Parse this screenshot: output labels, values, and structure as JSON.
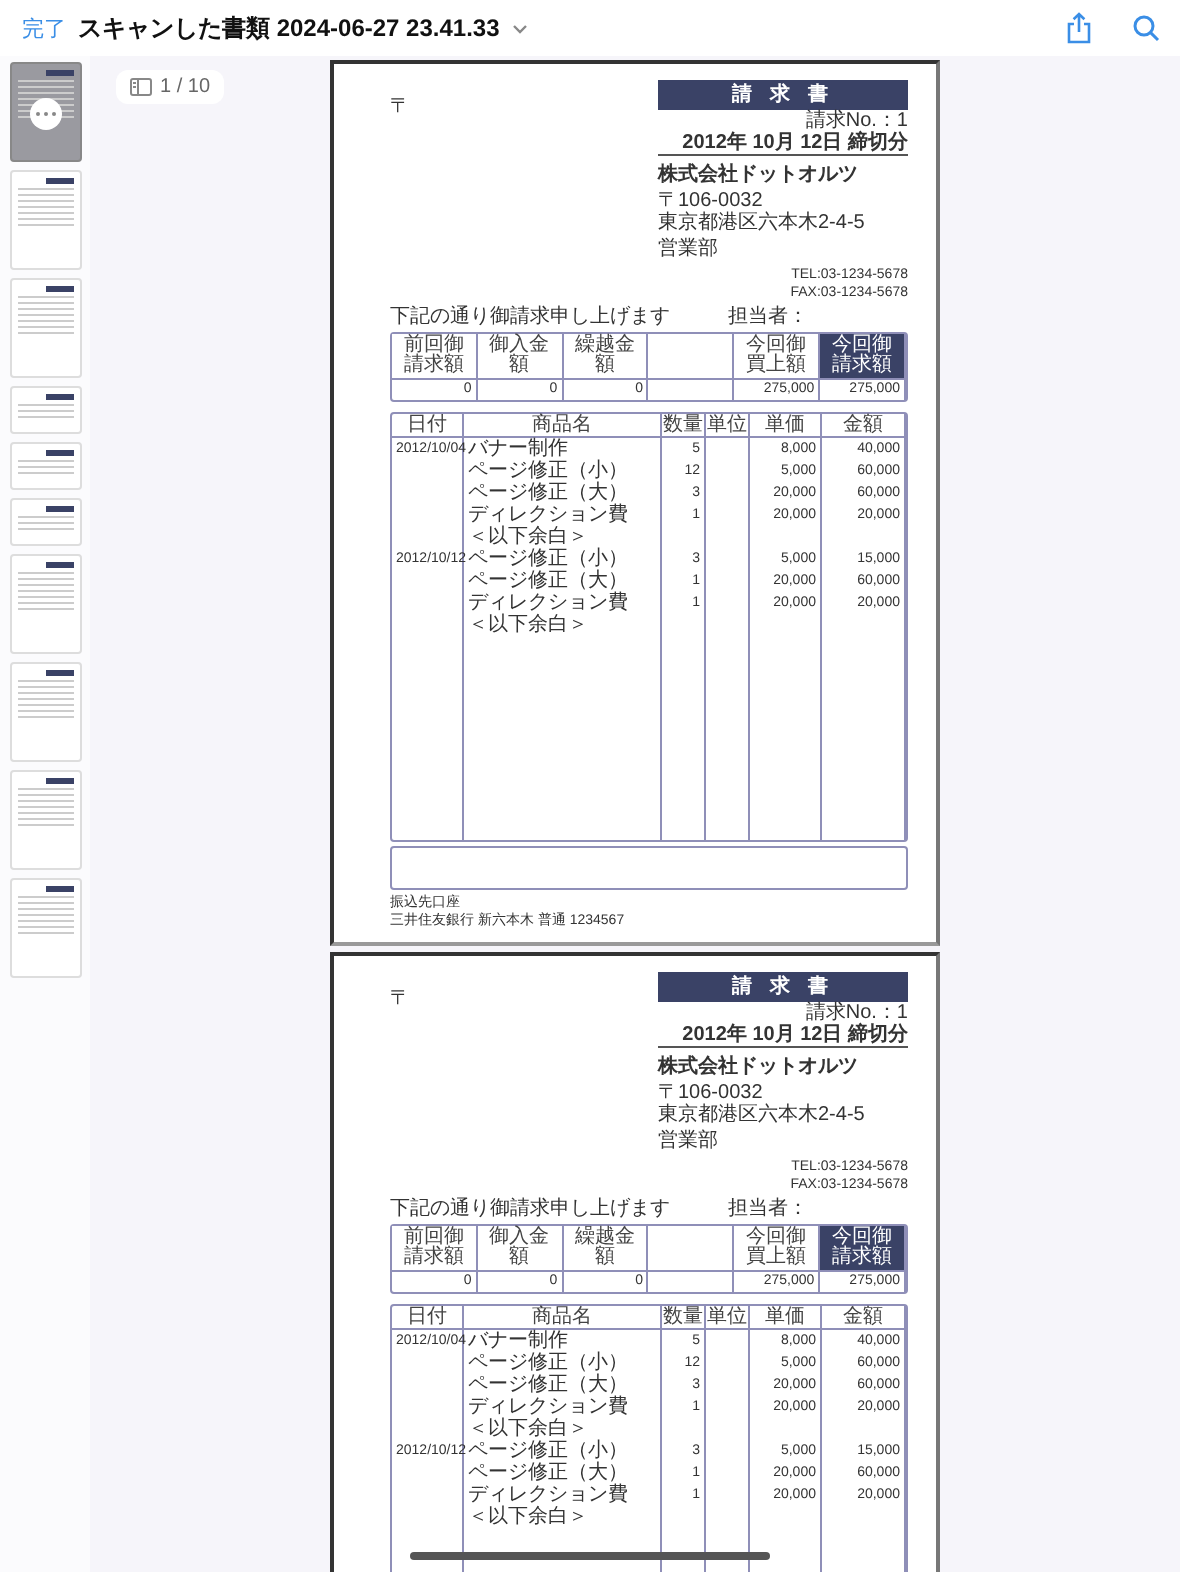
{
  "toolbar": {
    "done": "完了",
    "title": "スキャンした書類 2024-06-27 23.41.33"
  },
  "thumbnails": [
    {
      "selected": true,
      "kind": "portrait"
    },
    {
      "selected": false,
      "kind": "portrait"
    },
    {
      "selected": false,
      "kind": "portrait"
    },
    {
      "selected": false,
      "kind": "landscape"
    },
    {
      "selected": false,
      "kind": "landscape"
    },
    {
      "selected": false,
      "kind": "landscape"
    },
    {
      "selected": false,
      "kind": "portrait"
    },
    {
      "selected": false,
      "kind": "portrait"
    },
    {
      "selected": false,
      "kind": "portrait"
    },
    {
      "selected": false,
      "kind": "portrait"
    }
  ],
  "page_indicator": "1 / 10",
  "pages": [
    {
      "postal_mark": "〒",
      "title": "請 求 書",
      "invoice_no": "請求No.：1",
      "closing_date": "2012年 10月 12日 締切分",
      "company": "株式会社ドットオルツ",
      "postal_code": "〒106-0032",
      "address": "東京都港区六本木2-4-5",
      "department": "営業部",
      "tel": "TEL:03-1234-5678",
      "fax": "FAX:03-1234-5678",
      "message": "下記の通り御請求申し上げます",
      "contact": "担当者：",
      "summary": [
        {
          "label": "前回御請求額",
          "value": "0",
          "highlight": false
        },
        {
          "label": "御入金額",
          "value": "0",
          "highlight": false
        },
        {
          "label": "繰越金額",
          "value": "0",
          "highlight": false
        },
        {
          "highlight": false
        },
        {
          "label": "今回御買上額",
          "value": "275,000",
          "highlight": false
        },
        {
          "label": "今回御請求額",
          "value": "275,000",
          "highlight": true
        }
      ],
      "item_columns": [
        "日付",
        "商品名",
        "数量",
        "単位",
        "単価",
        "金額"
      ],
      "items": [
        {
          "date": "2012/10/04",
          "name": "バナー制作",
          "quantity": "5",
          "unit_price": "8,000",
          "amount": "40,000"
        },
        {
          "name": "ページ修正（小）",
          "quantity": "12",
          "unit_price": "5,000",
          "amount": "60,000"
        },
        {
          "name": "ページ修正（大）",
          "quantity": "3",
          "unit_price": "20,000",
          "amount": "60,000"
        },
        {
          "name": "ディレクション費",
          "quantity": "1",
          "unit_price": "20,000",
          "amount": "20,000"
        },
        {
          "name": "＜以下余白＞"
        },
        {
          "date": "2012/10/12",
          "name": "ページ修正（小）",
          "quantity": "3",
          "unit_price": "5,000",
          "amount": "15,000"
        },
        {
          "name": "ページ修正（大）",
          "quantity": "1",
          "unit_price": "20,000",
          "amount": "60,000"
        },
        {
          "name": "ディレクション費",
          "quantity": "1",
          "unit_price": "20,000",
          "amount": "20,000"
        },
        {
          "name": "＜以下余白＞"
        }
      ],
      "bank_label": "振込先口座",
      "bank_account": "三井住友銀行 新六本木 普通 1234567"
    },
    {
      "postal_mark": "〒",
      "title": "請 求 書",
      "invoice_no": "請求No.：1",
      "closing_date": "2012年 10月 12日 締切分",
      "company": "株式会社ドットオルツ",
      "postal_code": "〒106-0032",
      "address": "東京都港区六本木2-4-5",
      "department": "営業部",
      "tel": "TEL:03-1234-5678",
      "fax": "FAX:03-1234-5678",
      "message": "下記の通り御請求申し上げます",
      "contact": "担当者：",
      "summary": [
        {
          "label": "前回御請求額",
          "value": "0",
          "highlight": false
        },
        {
          "label": "御入金額",
          "value": "0",
          "highlight": false
        },
        {
          "label": "繰越金額",
          "value": "0",
          "highlight": false
        },
        {
          "highlight": false
        },
        {
          "label": "今回御買上額",
          "value": "275,000",
          "highlight": false
        },
        {
          "label": "今回御請求額",
          "value": "275,000",
          "highlight": true
        }
      ],
      "item_columns": [
        "日付",
        "商品名",
        "数量",
        "単位",
        "単価",
        "金額"
      ],
      "items": [
        {
          "date": "2012/10/04",
          "name": "バナー制作",
          "quantity": "5",
          "unit_price": "8,000",
          "amount": "40,000"
        },
        {
          "name": "ページ修正（小）",
          "quantity": "12",
          "unit_price": "5,000",
          "amount": "60,000"
        },
        {
          "name": "ページ修正（大）",
          "quantity": "3",
          "unit_price": "20,000",
          "amount": "60,000"
        },
        {
          "name": "ディレクション費",
          "quantity": "1",
          "unit_price": "20,000",
          "amount": "20,000"
        },
        {
          "name": "＜以下余白＞"
        },
        {
          "date": "2012/10/12",
          "name": "ページ修正（小）",
          "quantity": "3",
          "unit_price": "5,000",
          "amount": "15,000"
        },
        {
          "name": "ページ修正（大）",
          "quantity": "1",
          "unit_price": "20,000",
          "amount": "60,000"
        },
        {
          "name": "ディレクション費",
          "quantity": "1",
          "unit_price": "20,000",
          "amount": "20,000"
        },
        {
          "name": "＜以下余白＞"
        }
      ]
    }
  ]
}
